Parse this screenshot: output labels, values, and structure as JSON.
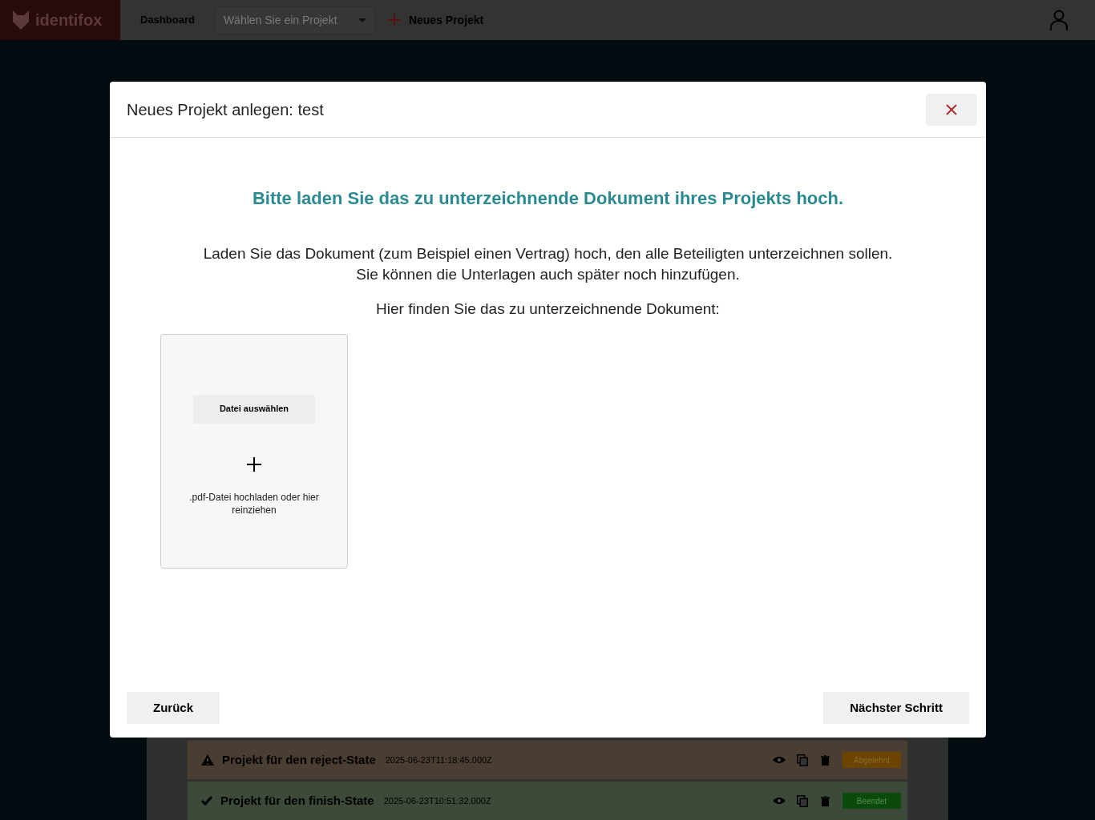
{
  "navbar": {
    "logo": "identifox",
    "dashboard": "Dashboard",
    "project_select": {
      "placeholder": "Wählen Sie ein Projekt"
    },
    "new_project": "Neues Projekt"
  },
  "projects": [
    {
      "kind": "rejected",
      "title": "Projekt für den reject-State",
      "date": "2025-06-23T11:18:45.000Z",
      "status": "Abgelehnt"
    },
    {
      "kind": "finished",
      "title": "Projekt für den finish-State",
      "date": "2025-06-23T10:51:32.000Z",
      "status": "Beendet"
    }
  ],
  "modal": {
    "title": "Neues Projekt anlegen: test",
    "heading": "Bitte laden Sie das zu unterzeichnende Dokument ihres Projekts hoch.",
    "description": [
      "Laden Sie das Dokument (zum Beispiel einen Vertrag) hoch, den alle Beteiligten unterzeichnen sollen.",
      "Sie können die Unterlagen auch später noch hinzufügen."
    ],
    "prompt": "Hier finden Sie das zu unterzeichnende Dokument:",
    "upload": {
      "button": "Datei auswählen",
      "hint": ".pdf-Datei hochladen oder hier reinziehen"
    },
    "back_button": "Zurück",
    "next_button": "Nächster Schritt"
  }
}
